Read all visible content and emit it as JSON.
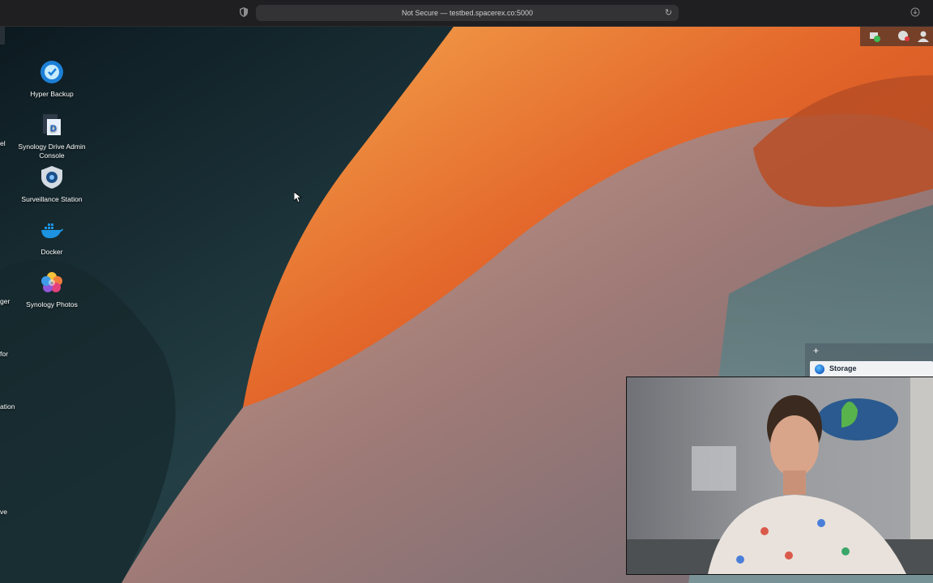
{
  "browser": {
    "url_text": "Not Secure — testbed.spacerex.co:5000"
  },
  "desktop_icons": [
    {
      "label": "Hyper Backup",
      "icon": "hyper-backup-icon"
    },
    {
      "label": "Synology Drive Admin Console",
      "icon": "synology-drive-icon"
    },
    {
      "label": "Surveillance Station",
      "icon": "surveillance-station-icon"
    },
    {
      "label": "Docker",
      "icon": "docker-icon"
    },
    {
      "label": "Synology Photos",
      "icon": "synology-photos-icon"
    }
  ],
  "partial_labels": [
    "el",
    "ger",
    "for",
    "ation",
    "ve"
  ],
  "widget": {
    "add_label": "+",
    "storage_label": "Storage"
  },
  "colors": {
    "accent": "#1b64c6"
  }
}
